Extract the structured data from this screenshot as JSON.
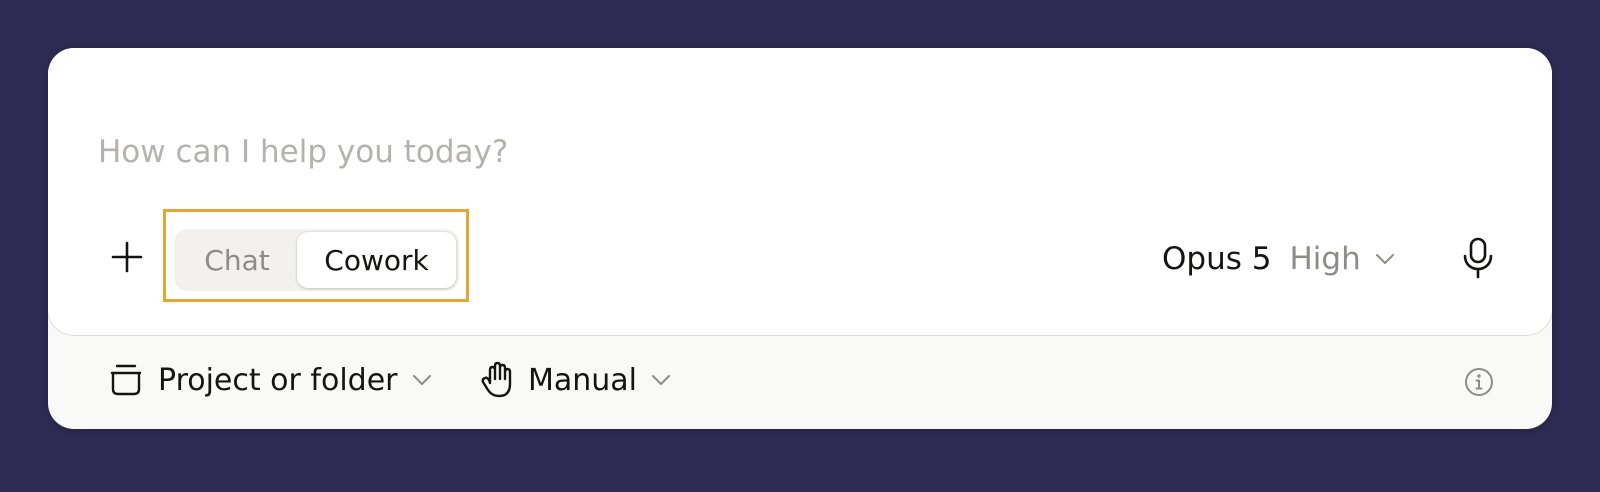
{
  "composer": {
    "placeholder": "How can I help you today?",
    "value": ""
  },
  "toolbar": {
    "add_icon": "plus-icon",
    "mode_tabs": [
      {
        "label": "Chat",
        "selected": false
      },
      {
        "label": "Cowork",
        "selected": true
      }
    ],
    "highlight_color": "#e3a735",
    "model": {
      "name": "Opus 5",
      "effort": "High",
      "icon": "chevron-down-icon"
    },
    "mic_icon": "microphone-icon"
  },
  "footer": {
    "project": {
      "label": "Project or folder",
      "icon": "folder-icon"
    },
    "permission": {
      "label": "Manual",
      "icon": "hand-icon"
    },
    "info_icon": "info-icon"
  },
  "colors": {
    "background": "#2f2b54",
    "card": "#ffffff",
    "footer": "#f9f9f8",
    "text_primary": "#141413",
    "text_muted": "#8d8c87"
  }
}
